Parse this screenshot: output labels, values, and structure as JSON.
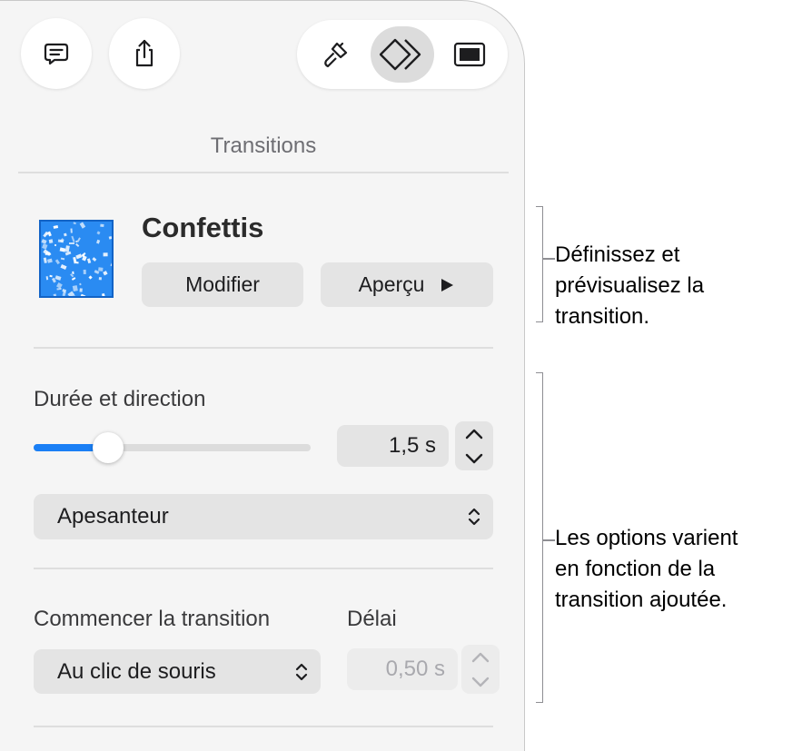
{
  "toolbar": {
    "comment_icon": "comment-bubble-icon",
    "share_icon": "share-icon",
    "format_icon": "paintbrush-icon",
    "animate_icon": "animate-diamonds-icon",
    "document_icon": "document-slide-icon",
    "active_tab": "animate"
  },
  "panel": {
    "section_title": "Transitions",
    "transition": {
      "name": "Confettis",
      "thumbnail_icon": "confetti-thumbnail",
      "modify_label": "Modifier",
      "preview_label": "Aperçu",
      "preview_icon": "play-triangle-icon"
    },
    "duration": {
      "label": "Durée et direction",
      "slider_fraction": 0.27,
      "value": "1,5 s",
      "direction": "Apesanteur"
    },
    "start": {
      "label": "Commencer la transition",
      "value": "Au clic de souris",
      "delay_label": "Délai",
      "delay_value": "0,50 s",
      "delay_enabled": false
    }
  },
  "callouts": {
    "top": [
      "Définissez et",
      "prévisualisez la",
      "transition."
    ],
    "bottom": [
      "Les options varient",
      "en fonction de la",
      "transition ajoutée."
    ]
  },
  "colors": {
    "accent": "#1a7ff5",
    "thumbnail": "#2a8bf2",
    "panel_background": "#f5f5f5"
  }
}
